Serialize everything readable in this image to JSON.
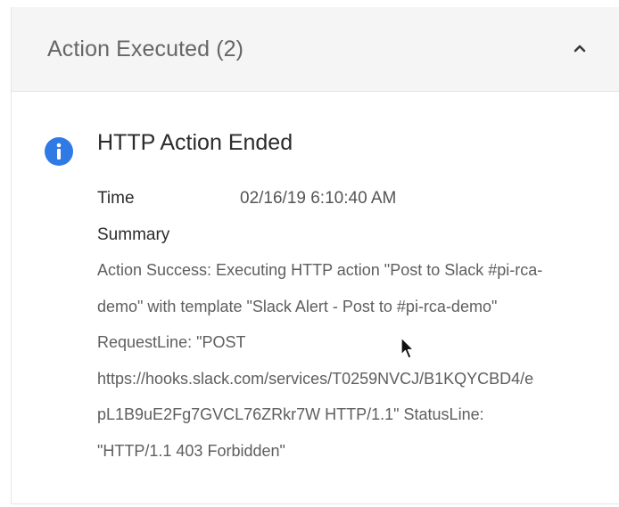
{
  "section": {
    "title": "Action Executed (2)"
  },
  "event": {
    "title": "HTTP Action Ended",
    "time_label": "Time",
    "time_value": "02/16/19 6:10:40 AM",
    "summary_label": "Summary",
    "summary_lines": [
      "Action Success: Executing HTTP action \"Post to Slack #pi-rca-",
      "demo\" with template \"Slack Alert - Post to #pi-rca-demo\"",
      "RequestLine: \"POST",
      "https://hooks.slack.com/services/T0259NVCJ/B1KQYCBD4/e",
      "pL1B9uE2Fg7GVCL76ZRkr7W HTTP/1.1\" StatusLine:",
      "\"HTTP/1.1 403 Forbidden\""
    ]
  },
  "icons": {
    "collapse": "chevron-up-icon",
    "info": "info-icon",
    "cursor": "mouse-pointer-icon"
  },
  "colors": {
    "info_blue": "#2f7ae5",
    "header_bg": "#f5f5f5"
  }
}
